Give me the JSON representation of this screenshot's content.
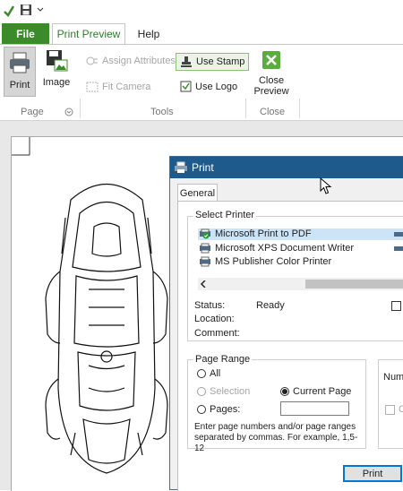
{
  "ribbon_tabs": {
    "file": "File",
    "print_preview": "Print Preview",
    "help": "Help"
  },
  "ribbon": {
    "print": "Print",
    "image": "Image",
    "assign_attributes": "Assign Attributes",
    "fit_camera": "Fit Camera",
    "use_stamp": "Use Stamp",
    "use_logo": "Use Logo",
    "close_preview_1": "Close",
    "close_preview_2": "Preview",
    "group_page": "Page",
    "group_tools": "Tools",
    "group_close": "Close"
  },
  "dialog": {
    "title": "Print",
    "tab_general": "General",
    "select_printer": "Select Printer",
    "printers": [
      "Microsoft Print to PDF",
      "Microsoft XPS Document Writer",
      "MS Publisher Color Printer"
    ],
    "status_label": "Status:",
    "status_value": "Ready",
    "location_label": "Location:",
    "comment_label": "Comment:",
    "page_range": "Page Range",
    "all": "All",
    "selection": "Selection",
    "current_page": "Current Page",
    "pages": "Pages:",
    "hint": "Enter page numbers and/or page ranges separated by commas.  For example, 1,5-12",
    "number_copies_partial": "Numb",
    "collate_partial": "C",
    "print_button": "Print"
  },
  "colors": {
    "accent_green": "#3c8b2a",
    "dialog_title": "#1f5a8c",
    "selected_row": "#cce4f7"
  }
}
